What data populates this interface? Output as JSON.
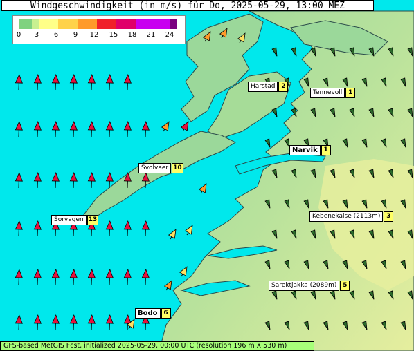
{
  "title": "Windgeschwindigkeit (in m/s) für Do, 2025-05-29, 13:00 MEZ",
  "legend": {
    "ticks": [
      "0",
      "3",
      "6",
      "9",
      "12",
      "15",
      "18",
      "21",
      "24"
    ],
    "colors": [
      "#7fd27f",
      "#c8f090",
      "#ffff88",
      "#ffd24a",
      "#ff9a2a",
      "#f0202a",
      "#e0006a",
      "#c800f0",
      "#7a0080"
    ]
  },
  "locations": [
    {
      "name": "Harstad",
      "value": "2",
      "bold": false
    },
    {
      "name": "Tennevoll",
      "value": "1",
      "bold": false
    },
    {
      "name": "Narvik",
      "value": "1",
      "bold": true
    },
    {
      "name": "Svolvaer",
      "value": "10",
      "bold": false
    },
    {
      "name": "Sorvagen",
      "value": "13",
      "bold": false
    },
    {
      "name": "Kebenekaise (2113m)",
      "value": "3",
      "bold": false
    },
    {
      "name": "Sarektjakka (2089m)",
      "value": "5",
      "bold": false
    },
    {
      "name": "Bodo",
      "value": "6",
      "bold": true
    }
  ],
  "footer": "GFS-based MetGIS Fcst, initialized 2025-05-29, 00:00 UTC  (resolution 196 m X 530 m)",
  "colors": {
    "sea": "#00e8ec",
    "land_low": "#8ed48a",
    "land_high": "#e8ef9a",
    "arrow_strong": "#e8103c",
    "arrow_medium": "#ff9a2a",
    "arrow_weak": "#ffe060",
    "arrow_calm": "#2a6a2a"
  }
}
